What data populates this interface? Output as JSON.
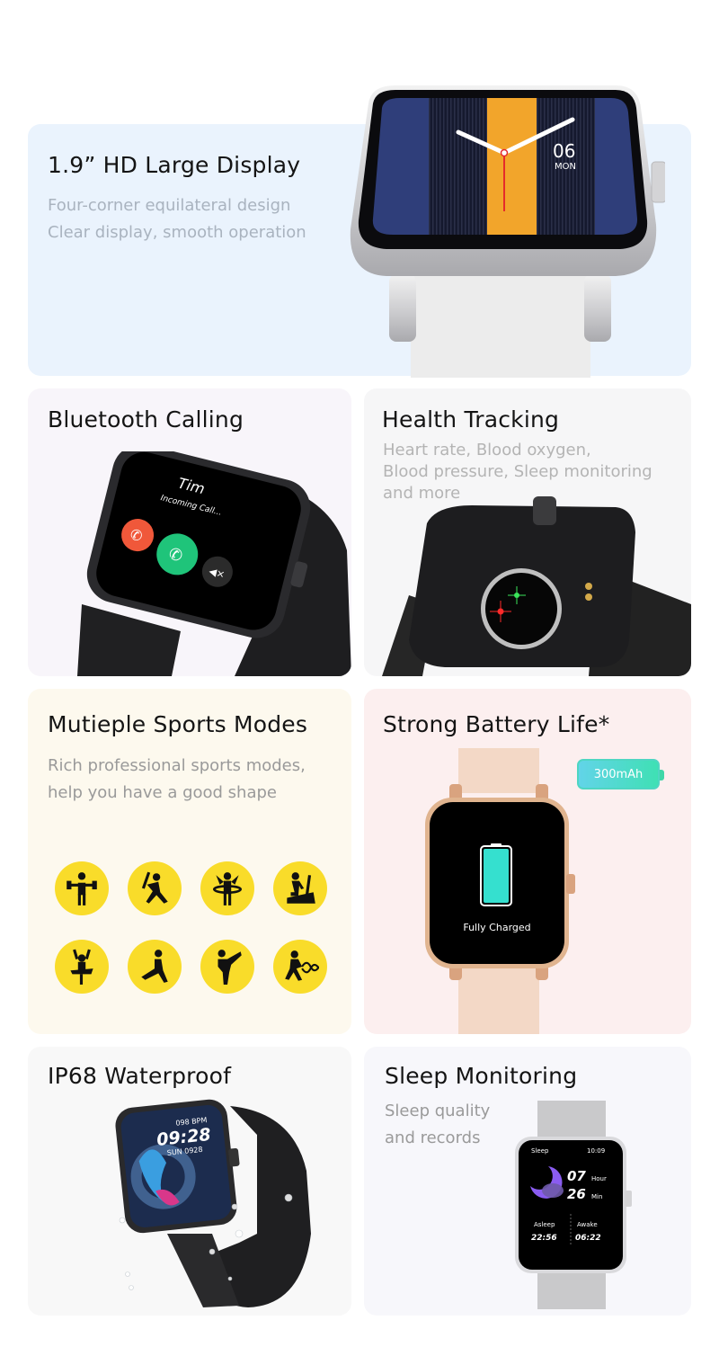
{
  "features": {
    "display": {
      "title": "1.9” HD Large Display",
      "lines": [
        "Four-corner equilateral design",
        "Clear display, smooth operation"
      ],
      "watch_face": {
        "day": "06",
        "weekday": "MON"
      }
    },
    "bluetooth": {
      "title": "Bluetooth Calling",
      "caller": "Tim",
      "status": "Incoming Call..."
    },
    "health": {
      "title": "Health Tracking",
      "lines": [
        "Heart rate, Blood oxygen,",
        "Blood pressure, Sleep monitoring",
        "and more"
      ]
    },
    "sports": {
      "title": "Mutieple Sports Modes",
      "lines": [
        "Rich professional sports modes,",
        "help you have a good shape"
      ],
      "icons": [
        "weightlifting-icon",
        "baseball-icon",
        "hula-hoop-icon",
        "elliptical-trainer-icon",
        "ballet-icon",
        "stretching-icon",
        "martial-arts-icon",
        "battle-rope-icon"
      ]
    },
    "battery": {
      "title": "Strong Battery Life*",
      "capacity": "300mAh",
      "screen_text": "Fully Charged",
      "charge_level": 1.0
    },
    "waterproof": {
      "title": "IP68 Waterproof",
      "screen": {
        "heart_rate": "098 BPM",
        "time": "09:28",
        "date": "SUN 0928"
      }
    },
    "sleep": {
      "title": "Sleep Monitoring",
      "lines": [
        "Sleep quality",
        "and records"
      ],
      "screen": {
        "label": "Sleep",
        "clock": "10:09",
        "hours": "07",
        "hours_unit": "Hour",
        "minutes": "26",
        "minutes_unit": "Min",
        "asleep_label": "Asleep",
        "asleep_time": "22:56",
        "awake_label": "Awake",
        "awake_time": "06:22"
      }
    }
  },
  "colors": {
    "sport_icon_bg": "#f9dc2a",
    "accept_call": "#1fc47a",
    "decline_call": "#f0583a",
    "battery_fill": "#35e0cf",
    "face_orange": "#f2a52b",
    "face_navy": "#2f3e7a"
  }
}
